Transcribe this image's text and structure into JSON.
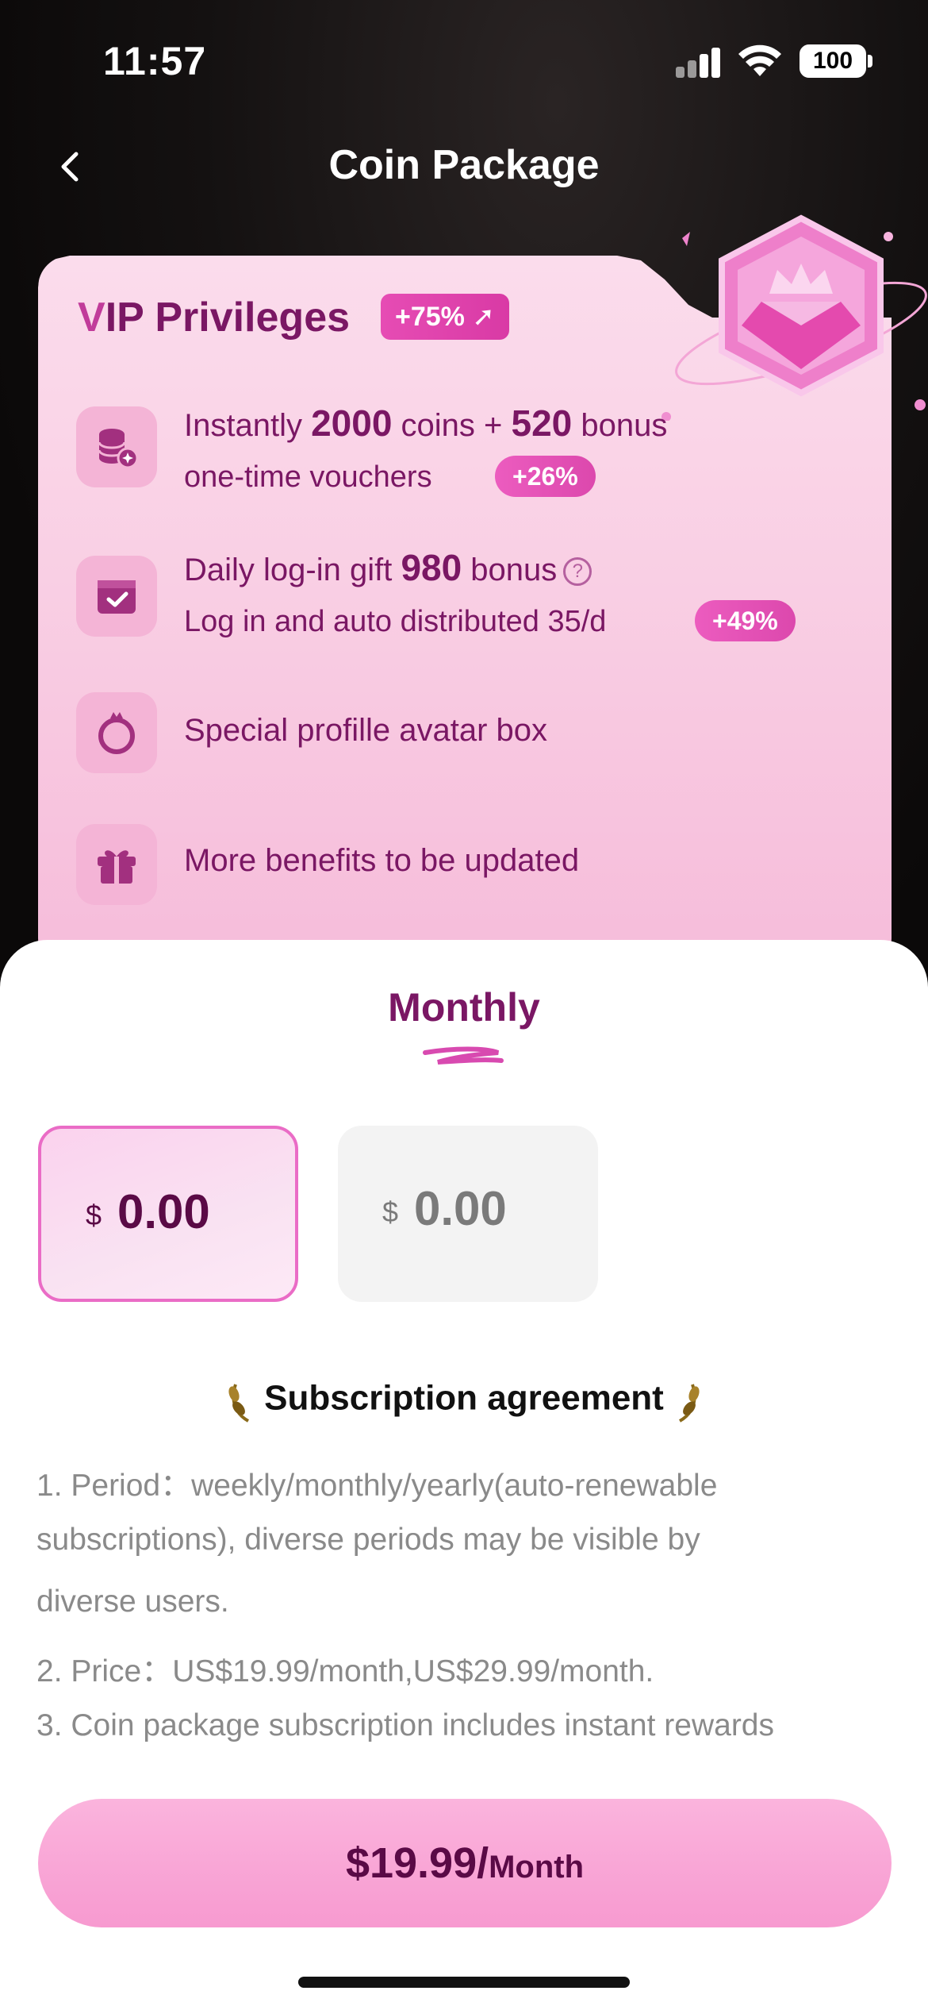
{
  "status_bar": {
    "time": "11:57",
    "battery": "100"
  },
  "header": {
    "title": "Coin Package"
  },
  "vip": {
    "title_prefix": "V",
    "title_rest": "IP Privileges",
    "badge": "+75%",
    "items": [
      {
        "line_pre": "Instantly ",
        "line_num1": "2000",
        "line_mid": " coins + ",
        "line_num2": "520",
        "line_post": " bonus",
        "sub": "one-time vouchers",
        "badge": "+26%",
        "icon": "coins-stack-icon"
      },
      {
        "line_pre": "Daily log-in gift ",
        "line_num1": "980",
        "line_post": " bonus",
        "help": "?",
        "sub": "Log in and auto distributed 35/d",
        "badge": "+49%",
        "icon": "calendar-check-icon"
      },
      {
        "line": "Special profille avatar box",
        "icon": "avatar-ring-icon"
      },
      {
        "line": "More benefits to be updated",
        "icon": "gift-icon"
      }
    ]
  },
  "plans": {
    "tab": "Monthly",
    "options": [
      {
        "currency": "$",
        "amount": "0.00",
        "selected": true
      },
      {
        "currency": "$",
        "amount": "0.00",
        "selected": false
      }
    ]
  },
  "agreement": {
    "title": "Subscription agreement",
    "lines": [
      "1. Period：weekly/monthly/yearly(auto-renewable",
      "subscriptions), diverse periods may be visible by",
      "diverse users.",
      "2. Price：US$19.99/month,US$29.99/month.",
      "3. Coin package subscription includes instant rewards"
    ]
  },
  "cta": {
    "price": "$19.99/",
    "unit": "Month"
  },
  "colors": {
    "accent": "#7a1764",
    "badge": "#e64cb4",
    "cta": "#f79ad0"
  }
}
